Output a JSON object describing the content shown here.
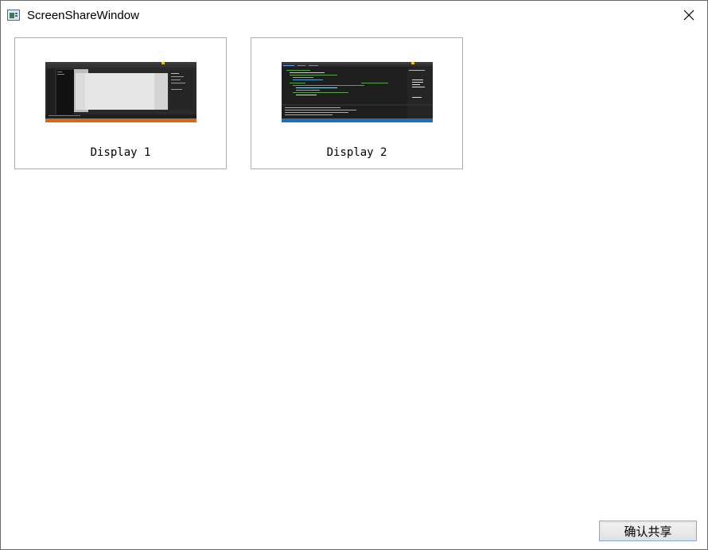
{
  "window": {
    "title": "ScreenShareWindow",
    "app_icon": "window-app-icon",
    "close_icon": "close-icon"
  },
  "displays": [
    {
      "label": "Display 1",
      "thumbnail": "desktop-thumbnail-dark-ide-with-white-window"
    },
    {
      "label": "Display 2",
      "thumbnail": "desktop-thumbnail-code-editor"
    }
  ],
  "footer": {
    "confirm_label": "确认共享"
  },
  "colors": {
    "card_border": "#acacac",
    "button_border": "#8aa6c8",
    "taskbar_orange": "#d2691e",
    "taskbar_blue": "#1e6fb8"
  }
}
